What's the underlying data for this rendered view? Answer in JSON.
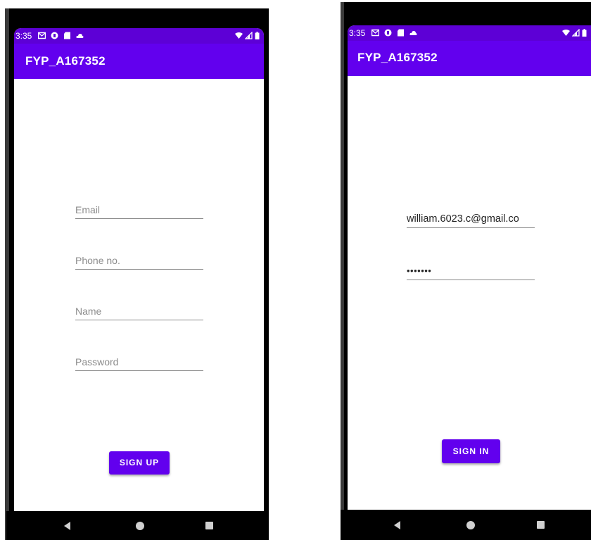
{
  "left_screen": {
    "status": {
      "time": "3:35"
    },
    "app_title": "FYP_A167352",
    "fields": [
      {
        "placeholder": "Email"
      },
      {
        "placeholder": "Phone no."
      },
      {
        "placeholder": "Name"
      },
      {
        "placeholder": "Password"
      }
    ],
    "button_label": "SIGN UP"
  },
  "right_screen": {
    "status": {
      "time": "3:35"
    },
    "app_title": "FYP_A167352",
    "email_value": "william.6023.c@gmail.co",
    "password_value": "•••••••",
    "button_label": "SIGN IN"
  },
  "icons": {
    "status_left": [
      "gmail-icon",
      "sync-icon",
      "sd-card-icon",
      "cloud-icon"
    ],
    "status_right": [
      "wifi-icon",
      "signal-icon",
      "battery-icon"
    ],
    "nav": [
      "back-icon",
      "home-icon",
      "recents-icon"
    ]
  },
  "colors": {
    "primary": "#6200ee",
    "status_bar": "#5d00d6"
  }
}
